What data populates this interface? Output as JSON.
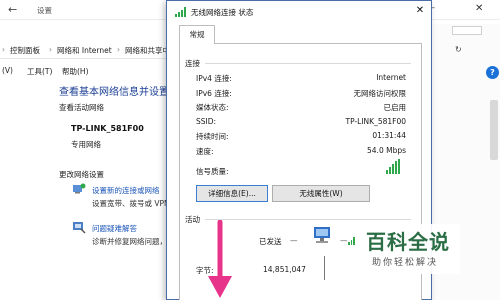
{
  "settings_window": {
    "title": "设置",
    "back_glyph": "←",
    "minimize_glyph": "—",
    "close_glyph": "✕"
  },
  "control_panel": {
    "breadcrumb": [
      "控制面板",
      "网络和 Internet",
      "网络和共享中"
    ],
    "breadcrumb_separator": "›",
    "menu": [
      "(V)",
      "工具(T)",
      "帮助(H)"
    ],
    "heading": "查看基本网络信息并设置连",
    "active_networks_label": "查看活动网络",
    "network_name": "TP-LINK_581F00",
    "network_type": "专用网络",
    "change_settings_label": "更改网络设置",
    "links": [
      {
        "label": "设置新的连接或网络",
        "desc": "设置宽带、拨号或 VPN"
      },
      {
        "label": "问题疑难解答",
        "desc": "诊断并修复网络问题，"
      }
    ],
    "help_glyph": "?"
  },
  "dialog": {
    "title": "无线网络连接 状态",
    "close_glyph": "✕",
    "tab": "常规",
    "connection_group": "连接",
    "rows": [
      {
        "label": "IPv4 连接:",
        "value": "Internet"
      },
      {
        "label": "IPv6 连接:",
        "value": "无网络访问权限"
      },
      {
        "label": "媒体状态:",
        "value": "已启用"
      },
      {
        "label": "SSID:",
        "value": "TP-LINK_581F00"
      },
      {
        "label": "持续时间:",
        "value": "01:31:44"
      },
      {
        "label": "速度:",
        "value": "54.0 Mbps"
      }
    ],
    "signal_label": "信号质量:",
    "signal_level": 1.0,
    "details_button": "详细信息(E)...",
    "wireless_props_button": "无线属性(W)",
    "activity_group": "活动",
    "sent_label": "已发送",
    "bytes_label": "字节:",
    "bytes_sent": "14,851,047"
  },
  "watermark": {
    "title": "百科全说",
    "subtitle": "助你轻松解决"
  },
  "colors": {
    "link_blue": "#1a55b8",
    "heading_blue": "#1b3f94",
    "signal_green": "#2ea84a",
    "arrow_pink": "#e8338a",
    "watermark_green": "#2b6d45"
  }
}
